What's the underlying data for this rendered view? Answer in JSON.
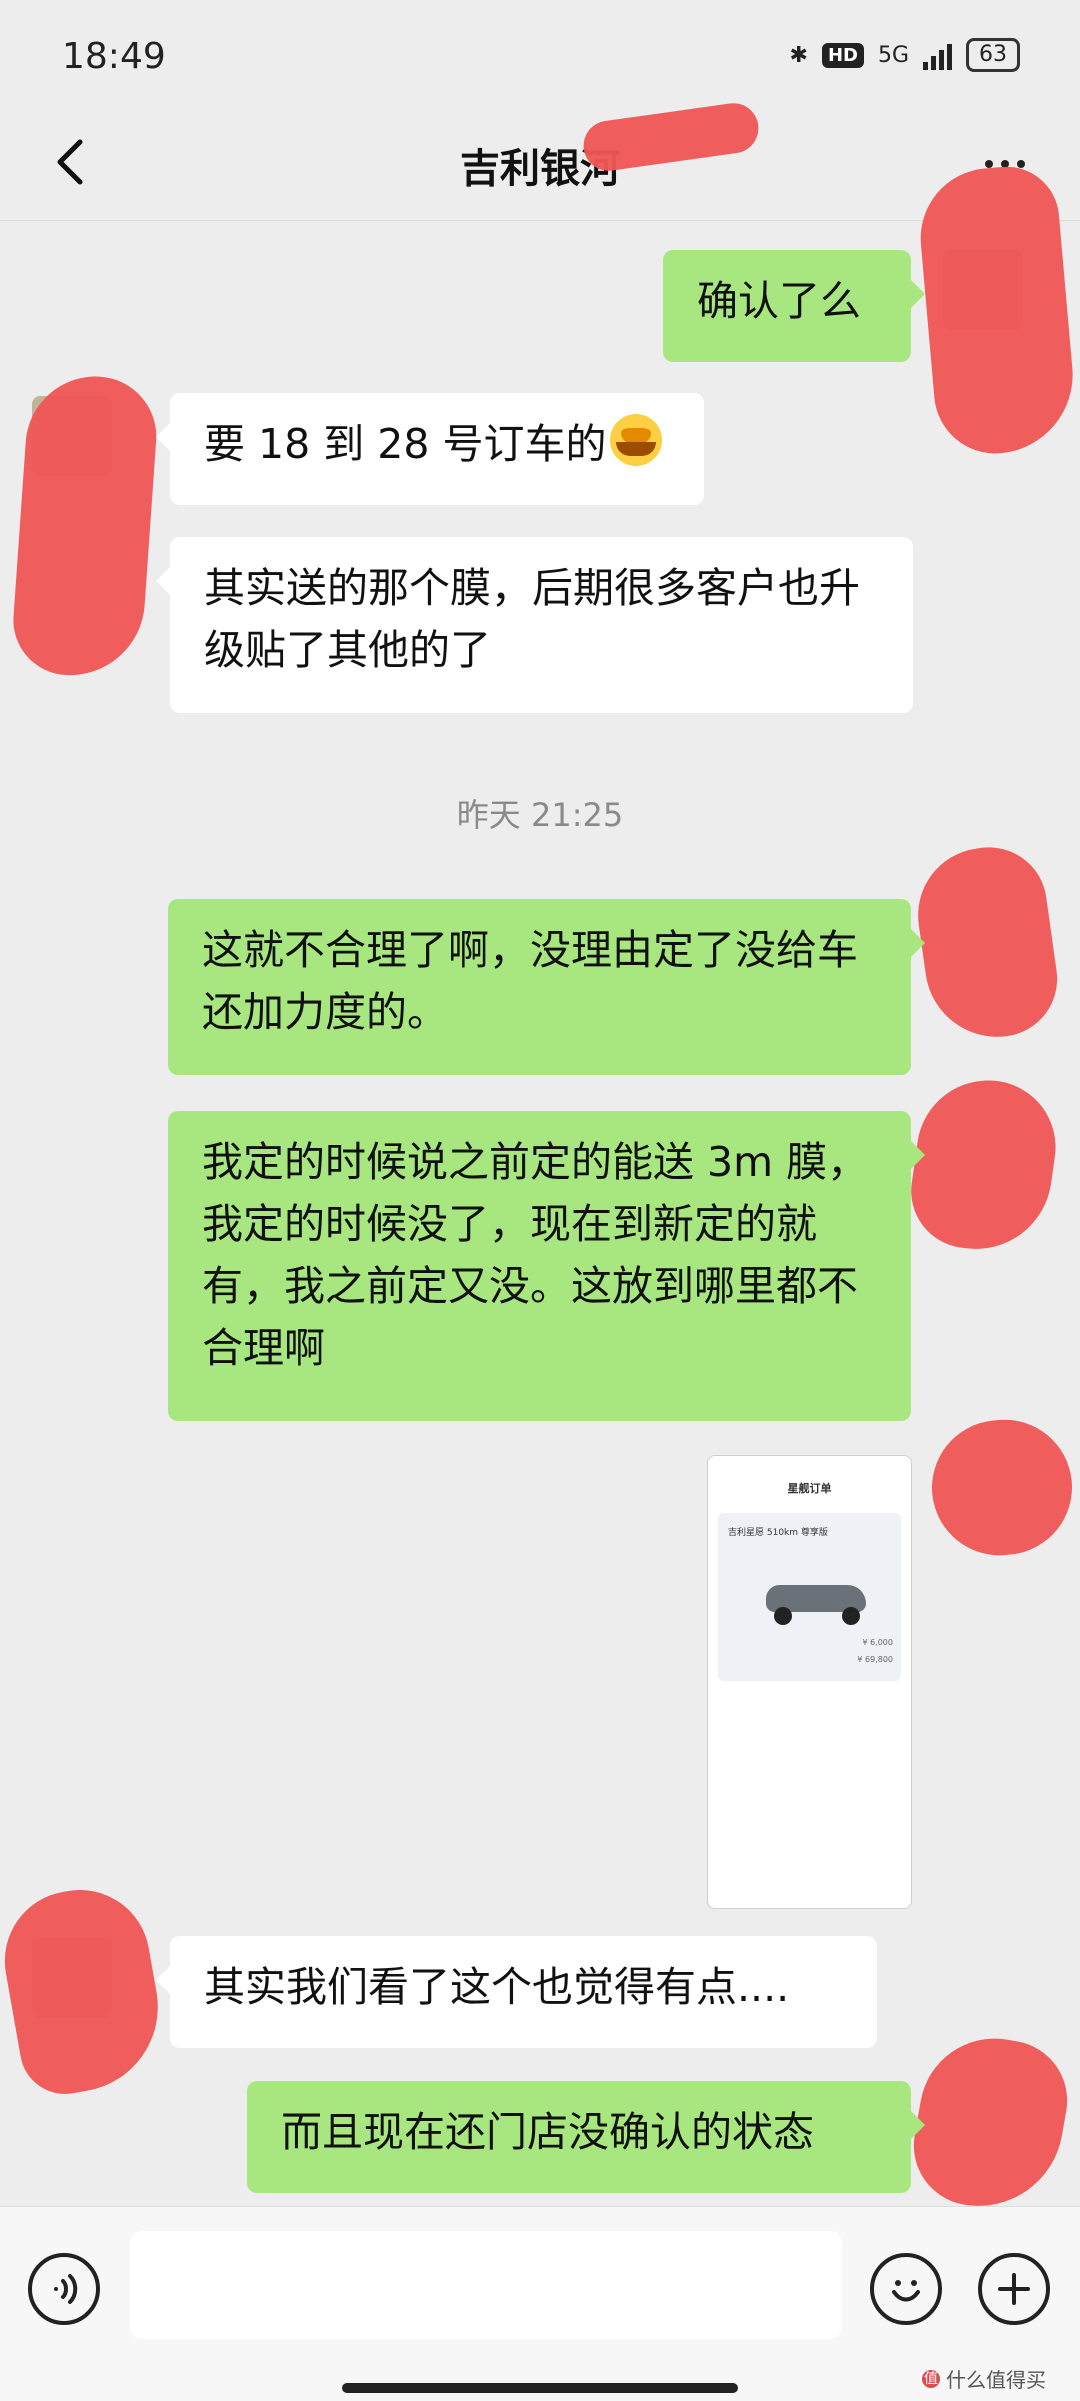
{
  "status_bar": {
    "time": "18:49",
    "hd_label": "HD",
    "network": "5G",
    "battery": "63"
  },
  "header": {
    "title": "吉利银河"
  },
  "messages": [
    {
      "side": "right",
      "text": "确认了么"
    },
    {
      "side": "left",
      "text": "要 18 到 28 号订车的",
      "emoji": "crying-laughing-emoji"
    },
    {
      "side": "left",
      "text": "其实送的那个膜，后期很多客户也升级贴了其他的了"
    },
    {
      "side": "right",
      "text": "这就不合理了啊，没理由定了没给车还加力度的。"
    },
    {
      "side": "right",
      "text": "我定的时候说之前定的能送 3m 膜，我定的时候没了，现在到新定的就有，我之前定又没。这放到哪里都不合理啊"
    },
    {
      "side": "left",
      "text": "其实我们看了这个也觉得有点...."
    },
    {
      "side": "right",
      "text": "而且现在还门店没确认的状态"
    }
  ],
  "timestamp": "昨天 21:25",
  "screenshot_thumb": {
    "title": "星舰订单",
    "car_name": "吉利星愿 510km 尊享版",
    "price_a": "¥ 6,000",
    "price_b": "¥ 69,800"
  },
  "inputbar": {
    "placeholder": ""
  },
  "watermark": {
    "text": "什么值得买"
  }
}
